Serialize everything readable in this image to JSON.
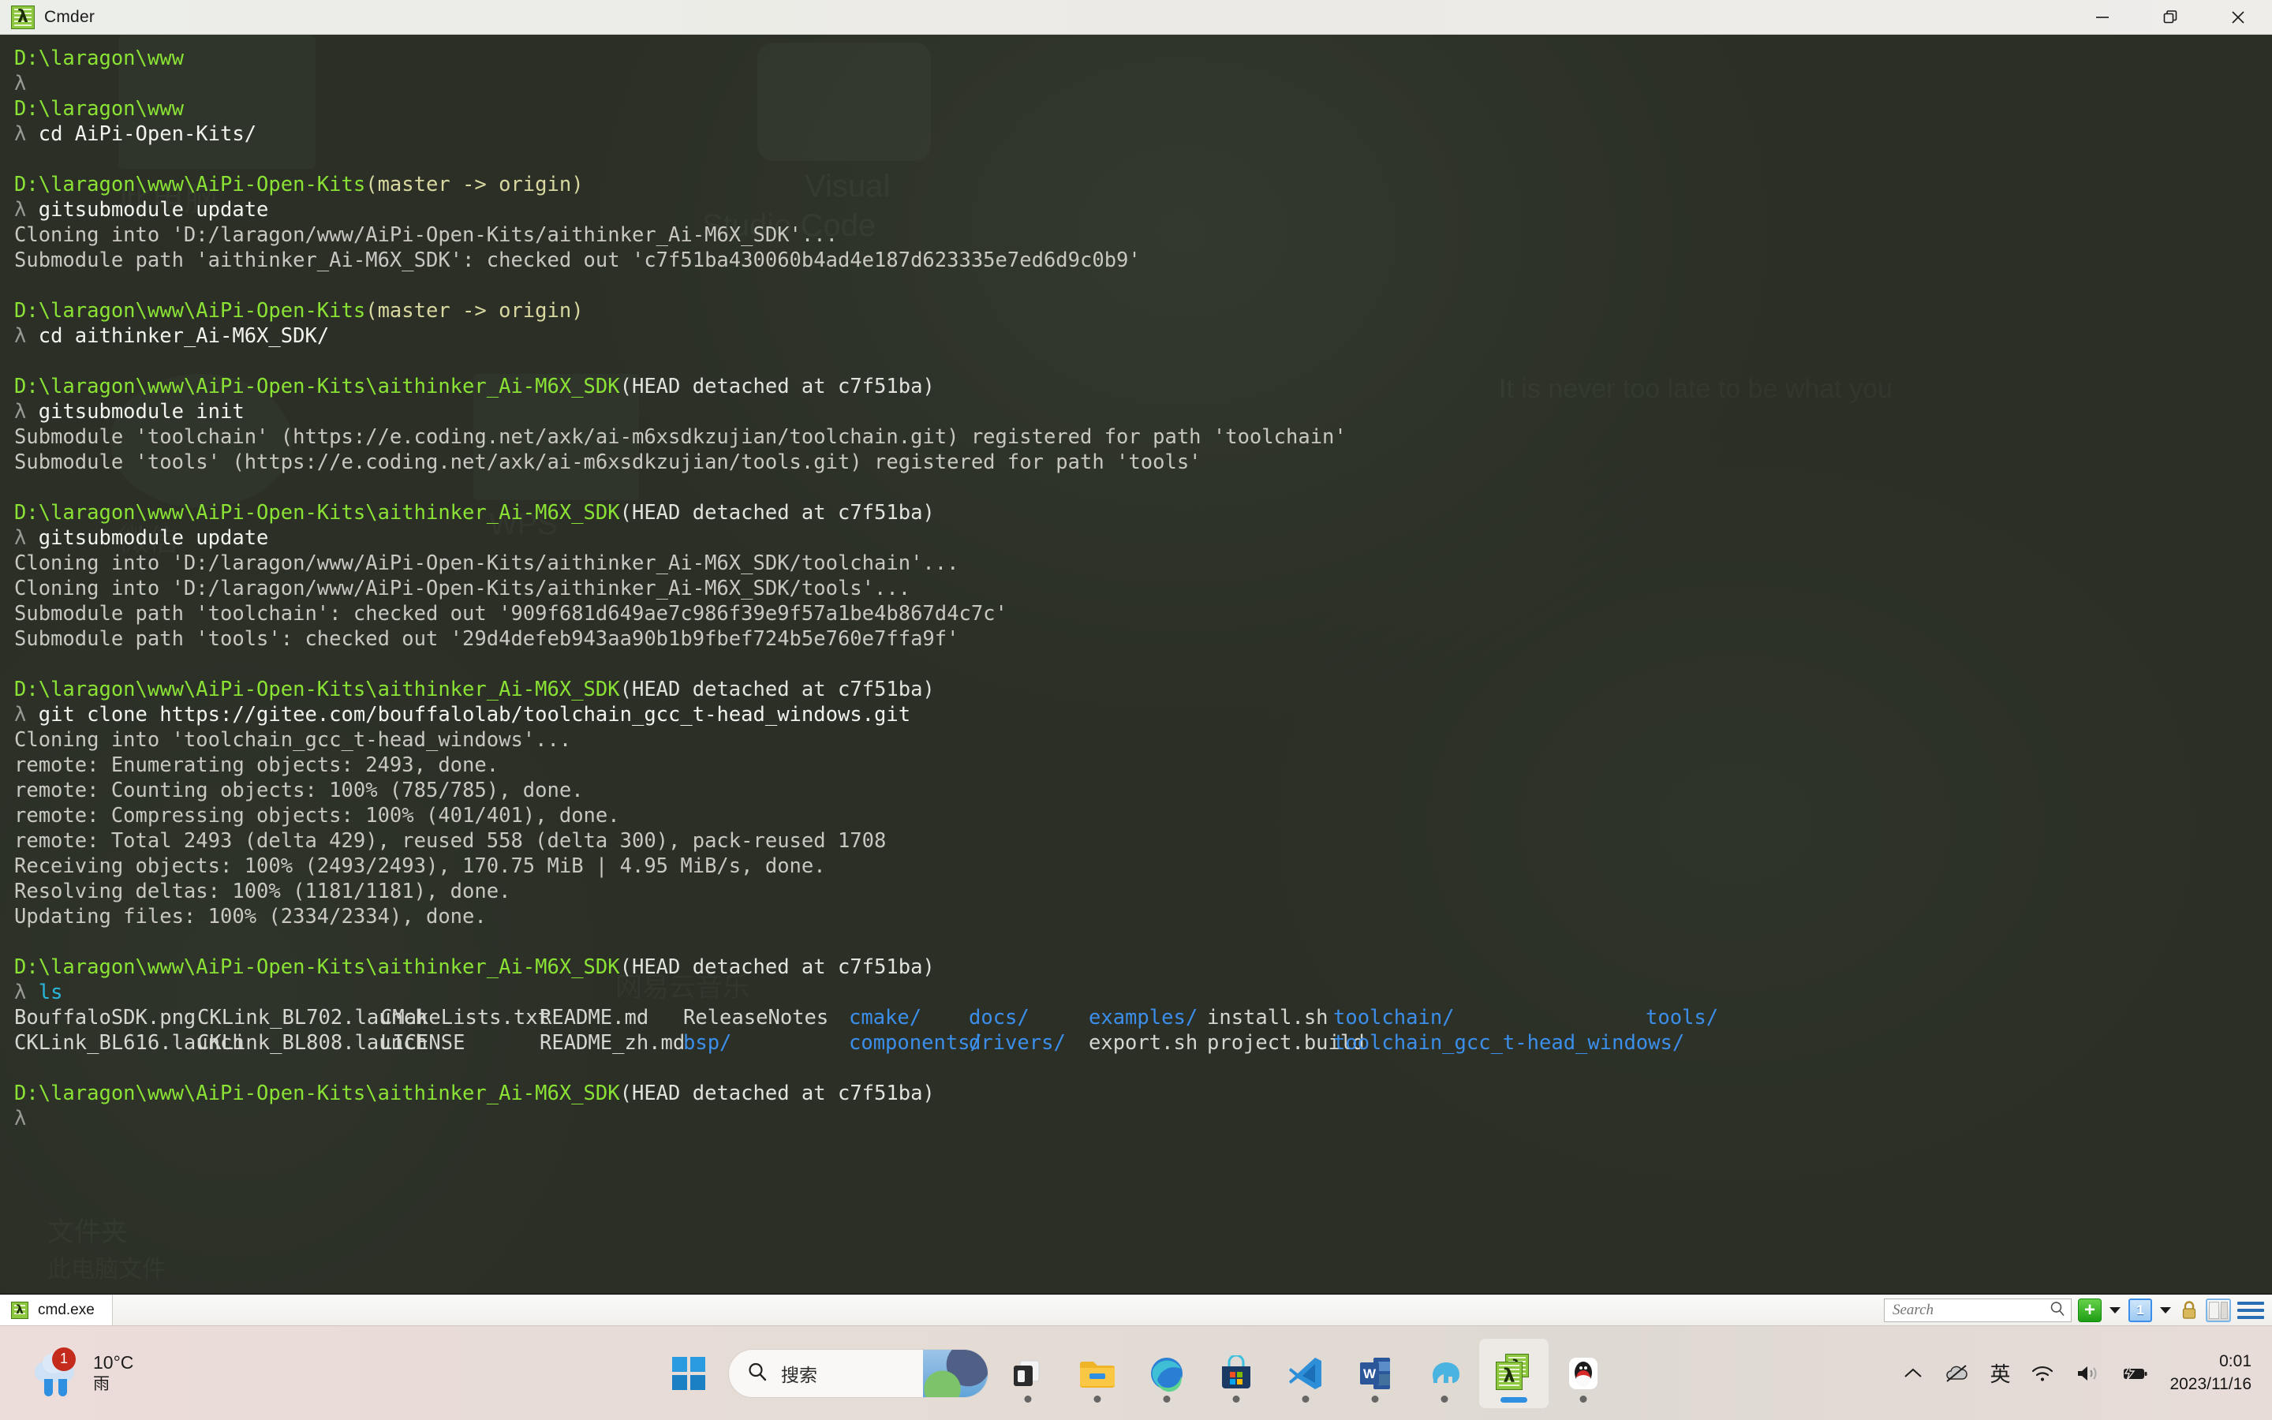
{
  "window": {
    "title": "Cmder",
    "icon": "cmder-lambda-icon",
    "controls": {
      "minimize": "minimize-icon",
      "restore": "restore-icon",
      "close": "close-icon"
    }
  },
  "terminal": {
    "lines": [
      {
        "type": "prompt_path",
        "text": "D:\\laragon\\www"
      },
      {
        "type": "prompt_cmd",
        "lambda": "λ",
        "cmd": ""
      },
      {
        "type": "prompt_path",
        "text": "D:\\laragon\\www"
      },
      {
        "type": "prompt_cmd",
        "lambda": "λ",
        "cmd": "cd AiPi-Open-Kits/"
      },
      {
        "type": "blank",
        "text": ""
      },
      {
        "type": "prompt_path_git",
        "path": "D:\\laragon\\www\\AiPi-Open-Kits",
        "git": "(master -> origin)"
      },
      {
        "type": "prompt_cmd",
        "lambda": "λ",
        "cmd": "gitsubmodule update"
      },
      {
        "type": "output",
        "text": "Cloning into 'D:/laragon/www/AiPi-Open-Kits/aithinker_Ai-M6X_SDK'..."
      },
      {
        "type": "output",
        "text": "Submodule path 'aithinker_Ai-M6X_SDK': checked out 'c7f51ba430060b4ad4e187d623335e7ed6d9c0b9'"
      },
      {
        "type": "blank",
        "text": ""
      },
      {
        "type": "prompt_path_git",
        "path": "D:\\laragon\\www\\AiPi-Open-Kits",
        "git": "(master -> origin)"
      },
      {
        "type": "prompt_cmd",
        "lambda": "λ",
        "cmd": "cd aithinker_Ai-M6X_SDK/"
      },
      {
        "type": "blank",
        "text": ""
      },
      {
        "type": "prompt_path_head",
        "path": "D:\\laragon\\www\\AiPi-Open-Kits\\aithinker_Ai-M6X_SDK",
        "head": "(HEAD detached at c7f51ba)"
      },
      {
        "type": "prompt_cmd",
        "lambda": "λ",
        "cmd": "gitsubmodule init"
      },
      {
        "type": "output",
        "text": "Submodule 'toolchain' (https://e.coding.net/axk/ai-m6xsdkzujian/toolchain.git) registered for path 'toolchain'"
      },
      {
        "type": "output",
        "text": "Submodule 'tools' (https://e.coding.net/axk/ai-m6xsdkzujian/tools.git) registered for path 'tools'"
      },
      {
        "type": "blank",
        "text": ""
      },
      {
        "type": "prompt_path_head",
        "path": "D:\\laragon\\www\\AiPi-Open-Kits\\aithinker_Ai-M6X_SDK",
        "head": "(HEAD detached at c7f51ba)"
      },
      {
        "type": "prompt_cmd",
        "lambda": "λ",
        "cmd": "gitsubmodule update"
      },
      {
        "type": "output",
        "text": "Cloning into 'D:/laragon/www/AiPi-Open-Kits/aithinker_Ai-M6X_SDK/toolchain'..."
      },
      {
        "type": "output",
        "text": "Cloning into 'D:/laragon/www/AiPi-Open-Kits/aithinker_Ai-M6X_SDK/tools'..."
      },
      {
        "type": "output",
        "text": "Submodule path 'toolchain': checked out '909f681d649ae7c986f39e9f57a1be4b867d4c7c'"
      },
      {
        "type": "output",
        "text": "Submodule path 'tools': checked out '29d4defeb943aa90b1b9fbef724b5e760e7ffa9f'"
      },
      {
        "type": "blank",
        "text": ""
      },
      {
        "type": "prompt_path_head",
        "path": "D:\\laragon\\www\\AiPi-Open-Kits\\aithinker_Ai-M6X_SDK",
        "head": "(HEAD detached at c7f51ba)"
      },
      {
        "type": "prompt_cmd",
        "lambda": "λ",
        "cmd": "git clone https://gitee.com/bouffalolab/toolchain_gcc_t-head_windows.git"
      },
      {
        "type": "output",
        "text": "Cloning into 'toolchain_gcc_t-head_windows'..."
      },
      {
        "type": "output",
        "text": "remote: Enumerating objects: 2493, done."
      },
      {
        "type": "output",
        "text": "remote: Counting objects: 100% (785/785), done."
      },
      {
        "type": "output",
        "text": "remote: Compressing objects: 100% (401/401), done."
      },
      {
        "type": "output",
        "text": "remote: Total 2493 (delta 429), reused 558 (delta 300), pack-reused 1708"
      },
      {
        "type": "output",
        "text": "Receiving objects: 100% (2493/2493), 170.75 MiB | 4.95 MiB/s, done."
      },
      {
        "type": "output",
        "text": "Resolving deltas: 100% (1181/1181), done."
      },
      {
        "type": "output",
        "text": "Updating files: 100% (2334/2334), done."
      },
      {
        "type": "blank",
        "text": ""
      },
      {
        "type": "prompt_path_head",
        "path": "D:\\laragon\\www\\AiPi-Open-Kits\\aithinker_Ai-M6X_SDK",
        "head": "(HEAD detached at c7f51ba)"
      },
      {
        "type": "prompt_ls",
        "lambda": "λ",
        "cmd": "ls"
      },
      {
        "type": "ls_row1"
      },
      {
        "type": "ls_row2"
      },
      {
        "type": "blank",
        "text": ""
      },
      {
        "type": "prompt_path_head",
        "path": "D:\\laragon\\www\\AiPi-Open-Kits\\aithinker_Ai-M6X_SDK",
        "head": "(HEAD detached at c7f51ba)"
      },
      {
        "type": "prompt_cmd",
        "lambda": "λ",
        "cmd": ""
      }
    ],
    "ls_output": {
      "row1": [
        {
          "name": "BouffaloSDK.png",
          "kind": "file"
        },
        {
          "name": "CKLink_BL702.launch",
          "kind": "file"
        },
        {
          "name": "CMakeLists.txt",
          "kind": "file"
        },
        {
          "name": "README.md",
          "kind": "file"
        },
        {
          "name": "ReleaseNotes",
          "kind": "file"
        },
        {
          "name": "cmake/",
          "kind": "dir"
        },
        {
          "name": "docs/",
          "kind": "dir"
        },
        {
          "name": "examples/",
          "kind": "dir"
        },
        {
          "name": "install.sh",
          "kind": "file"
        },
        {
          "name": "toolchain/",
          "kind": "dir"
        },
        {
          "name": "tools/",
          "kind": "dir"
        }
      ],
      "row2": [
        {
          "name": "CKLink_BL616.launch",
          "kind": "file"
        },
        {
          "name": "CKLink_BL808.launch",
          "kind": "file"
        },
        {
          "name": "LICENSE",
          "kind": "file"
        },
        {
          "name": "README_zh.md",
          "kind": "file"
        },
        {
          "name": "bsp/",
          "kind": "dir"
        },
        {
          "name": "components/",
          "kind": "dir"
        },
        {
          "name": "drivers/",
          "kind": "dir"
        },
        {
          "name": "export.sh",
          "kind": "file"
        },
        {
          "name": "project.build",
          "kind": "file"
        },
        {
          "name": "toolchain_gcc_t-head_windows/",
          "kind": "dir"
        },
        {
          "name": "",
          "kind": "file"
        }
      ]
    },
    "colors": {
      "path": "#8ae234",
      "git_branch": "#d8d8a0",
      "head_detached": "#e3e3de",
      "lambda": "#9a9a94",
      "command": "#f2f2ee",
      "output": "#c8c8c1",
      "directory": "#3b8eea",
      "ls_command": "#29b8db",
      "background": "#2b2f26"
    }
  },
  "statusbar": {
    "tab_label": "cmd.exe",
    "tab_icon": "cmder-lambda-icon",
    "search_placeholder": "Search",
    "search_value": "",
    "search_icon": "magnifier-icon",
    "new_tab_label": "+",
    "new_tab_icon": "plus-icon",
    "new_tab_caret": "chevron-down-icon",
    "tab_count": "1",
    "tab_count_caret": "chevron-down-icon",
    "lock_icon": "lock-icon",
    "panel_icon": "split-panel-icon",
    "menu_icon": "hamburger-menu-icon"
  },
  "taskbar": {
    "weather": {
      "badge": "1",
      "temperature": "10°C",
      "condition": "雨",
      "icon": "rain-cloud-icon"
    },
    "start_icon": "windows-start-icon",
    "search_placeholder": "搜索",
    "search_icon": "search-icon",
    "apps": [
      {
        "name": "task-view",
        "icon": "task-view-icon"
      },
      {
        "name": "file-explorer",
        "icon": "folder-icon",
        "running": true
      },
      {
        "name": "microsoft-edge",
        "icon": "edge-icon",
        "running": true
      },
      {
        "name": "microsoft-store",
        "icon": "store-icon",
        "running": true
      },
      {
        "name": "visual-studio-code",
        "icon": "vscode-icon",
        "running": true
      },
      {
        "name": "microsoft-word",
        "icon": "word-icon",
        "running": true
      },
      {
        "name": "laragon",
        "icon": "elephant-icon",
        "running": true
      },
      {
        "name": "cmder",
        "icon": "cmder-lambda-icon",
        "running": true,
        "active": true
      },
      {
        "name": "qq",
        "icon": "penguin-icon",
        "running": true
      }
    ],
    "tray": {
      "overflow_icon": "chevron-up-icon",
      "onedrive_icon": "onedrive-offline-icon",
      "ime_label": "英",
      "wifi_icon": "wifi-icon",
      "volume_icon": "speaker-icon",
      "battery_icon": "battery-charging-icon",
      "time": "0:01",
      "date": "2023/11/16"
    }
  }
}
